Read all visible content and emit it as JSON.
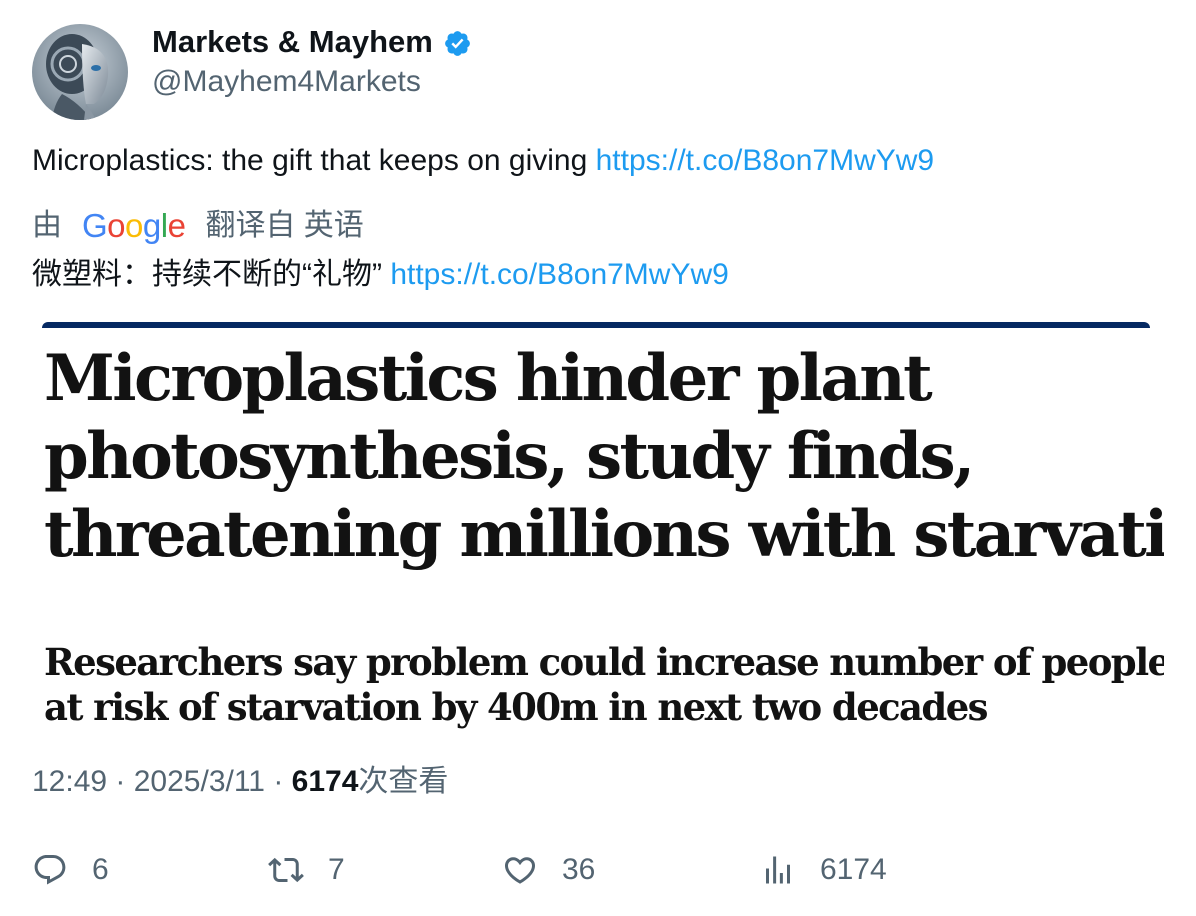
{
  "author": {
    "display_name": "Markets & Mayhem",
    "handle": "@Mayhem4Markets",
    "verified": true,
    "verified_color": "#1d9bf0"
  },
  "tweet": {
    "text": "Microplastics: the gift that keeps on giving ",
    "link": "https://t.co/B8on7MwYw9"
  },
  "translation": {
    "by_label": "由",
    "provider_logo": "Google",
    "from_label": "翻译自 英语",
    "text": "微塑料：持续不断的“礼物” ",
    "link": "https://t.co/B8on7MwYw9"
  },
  "media": {
    "headline_lines": [
      "Microplastics hinder plant",
      "photosynthesis, study finds,",
      "threatening millions with starvation"
    ],
    "standfirst_lines": [
      "Researchers say problem could increase number of people",
      "at risk of starvation by 400m in next two decades"
    ],
    "topbar_color": "#052962"
  },
  "meta": {
    "time": "12:49",
    "separator": " · ",
    "date": "2025/3/11",
    "views_count": "6174",
    "views_label": "次查看"
  },
  "actions": {
    "reply_count": "6",
    "retweet_count": "7",
    "like_count": "36",
    "views_count": "6174"
  },
  "colors": {
    "link": "#1d9bf0",
    "secondary_text": "#536471",
    "primary_text": "#0f1419"
  }
}
